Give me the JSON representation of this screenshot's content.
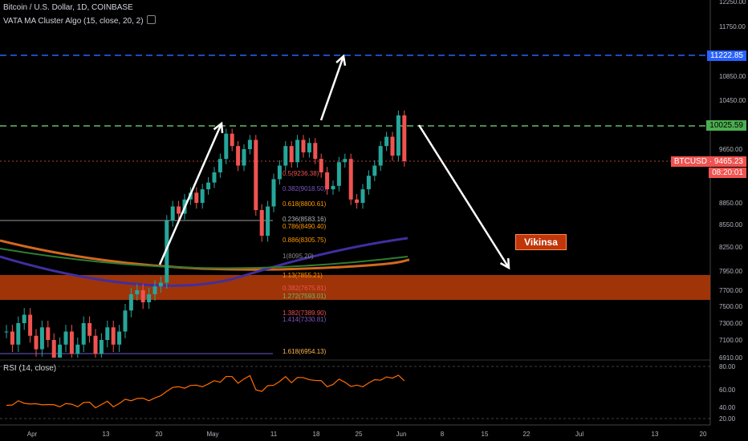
{
  "header": {
    "symbol_line": "Bitcoin / U.S. Dollar, 1D, COINBASE",
    "indicator_line": "VATA MA Cluster Algo (15, close, 20, 2)"
  },
  "rsi": {
    "label": "RSI (14, close)",
    "ticks": [
      "80.00",
      "60.00",
      "40.00",
      "20.00"
    ]
  },
  "badges": {
    "level_blue": "11222.85",
    "level_green": "10025.59",
    "ticker": "BTCUSD",
    "ticker_price": "9465.23",
    "countdown": "08:20:01"
  },
  "watermark": "Vikinsa",
  "chart_data": {
    "type": "candlestick",
    "y_ticks": [
      "12250.00",
      "11750.00",
      "11222.85",
      "10850.00",
      "10450.00",
      "10025.59",
      "9650.00",
      "9465.23",
      "8850.00",
      "8550.00",
      "8250.00",
      "7950.00",
      "7700.00",
      "7500.00",
      "7300.00",
      "7100.00",
      "6910.00"
    ],
    "x_ticks": [
      "Apr",
      "13",
      "20",
      "May",
      "11",
      "18",
      "25",
      "Jun",
      "8",
      "15",
      "22",
      "Jul",
      "13",
      "20"
    ],
    "fib_levels": [
      {
        "label": "0.236(8583.16)"
      },
      {
        "label": "0.382(9018.50)"
      },
      {
        "label": "0.5(9236.38)"
      },
      {
        "label": "0.618(8800.61)"
      },
      {
        "label": "0.786(8490.40)"
      },
      {
        "label": "0.886(8305.75)"
      },
      {
        "label": "1(8095.20)"
      },
      {
        "label": "1.13(7855.21)"
      },
      {
        "label": "0.382(7675.81)"
      },
      {
        "label": "1.272(7593.01)"
      },
      {
        "label": "1.382(7389.90)"
      },
      {
        "label": "1.414(7330.81)"
      },
      {
        "label": "1.618(6954.13)"
      }
    ],
    "colors": {
      "up": "#26a69a",
      "down": "#ef5350",
      "zone": "#b03a0a",
      "blue_line": "#2962ff",
      "green_line": "#66bb6a"
    }
  }
}
